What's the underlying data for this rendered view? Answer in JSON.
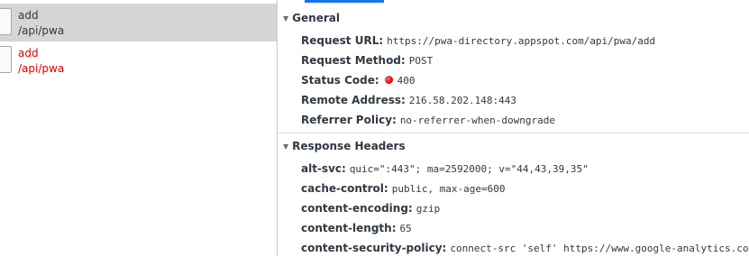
{
  "requests": [
    {
      "name": "add",
      "path": "/api/pwa",
      "selected": true,
      "error": false
    },
    {
      "name": "add",
      "path": "/api/pwa",
      "selected": false,
      "error": true
    }
  ],
  "general": {
    "title": "General",
    "request_url_label": "Request URL:",
    "request_url": "https://pwa-directory.appspot.com/api/pwa/add",
    "request_method_label": "Request Method:",
    "request_method": "POST",
    "status_code_label": "Status Code:",
    "status_code": "400",
    "remote_address_label": "Remote Address:",
    "remote_address": "216.58.202.148:443",
    "referrer_policy_label": "Referrer Policy:",
    "referrer_policy": "no-referrer-when-downgrade"
  },
  "response_headers": {
    "title": "Response Headers",
    "items": [
      {
        "key": "alt-svc:",
        "value": "quic=\":443\"; ma=2592000; v=\"44,43,39,35\""
      },
      {
        "key": "cache-control:",
        "value": "public, max-age=600"
      },
      {
        "key": "content-encoding:",
        "value": "gzip"
      },
      {
        "key": "content-length:",
        "value": "65"
      },
      {
        "key": "content-security-policy:",
        "value": "connect-src 'self' https://www.google-analytics.com ht"
      }
    ]
  },
  "colors": {
    "selected_row": "#d6d6d6",
    "error_text": "#e10000",
    "tab_accent": "#1a73e8",
    "status_dot": "#d40000"
  }
}
